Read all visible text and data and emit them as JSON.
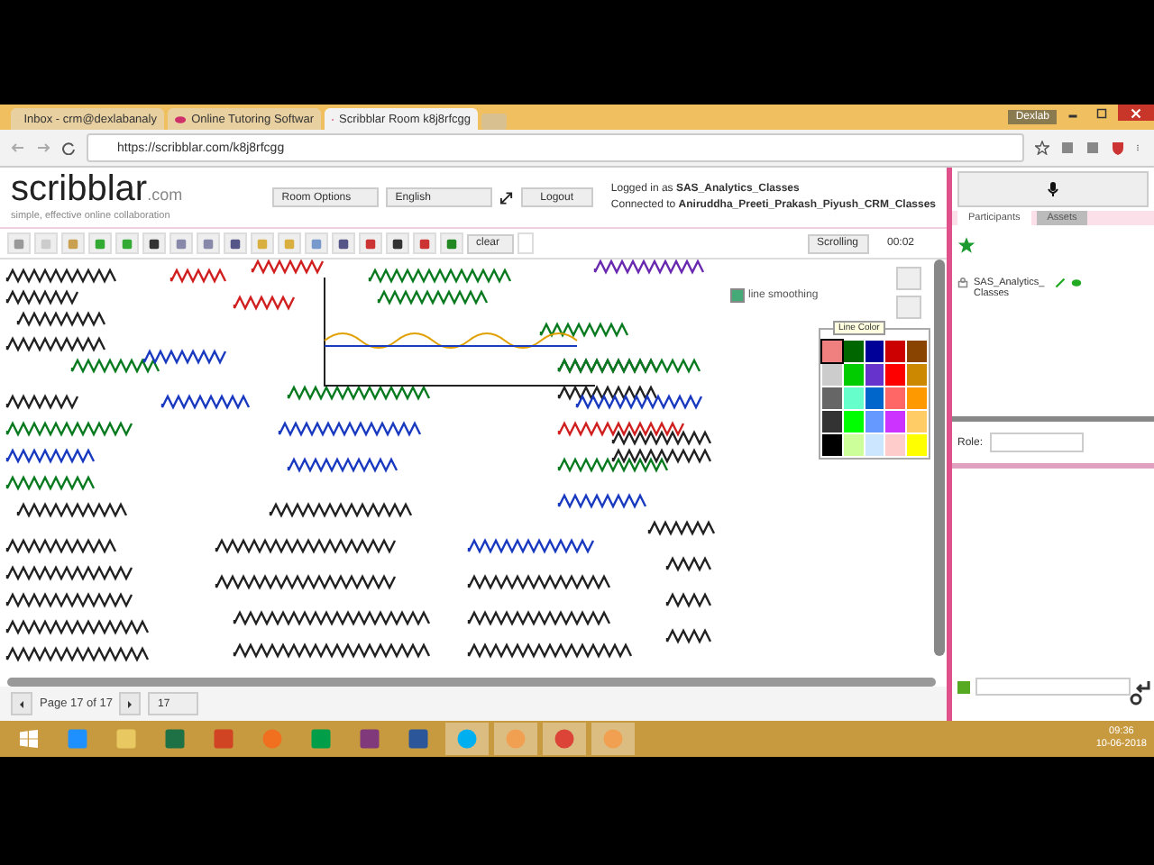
{
  "browser": {
    "tabs": [
      {
        "label": "Inbox - crm@dexlabanaly",
        "selected": false
      },
      {
        "label": "Online Tutoring Softwar",
        "selected": false
      },
      {
        "label": "Scribblar Room k8j8rfcgg",
        "selected": true
      }
    ],
    "profile": "Dexlab",
    "address": "https://scribblar.com/k8j8rfcgg"
  },
  "header": {
    "logo": "scribblar",
    "logo_suffix": ".com",
    "tagline": "simple, effective online collaboration",
    "room_options": "Room Options",
    "language": "English",
    "logout": "Logout",
    "logged_in": "Logged in as **SAS_Analytics_Classes**",
    "connected": "Connected to **Aniruddha_Preeti_Prakash_Piyush_CRM_Classes**"
  },
  "toolbar": {
    "clear": "clear",
    "mode": "Scrolling",
    "timer": "00:02"
  },
  "whiteboard": {
    "line_smoothing": {
      "label": "line smoothing",
      "checked": true
    },
    "color_tooltip": "Line Color",
    "swatches": [
      {
        "color": "#f08080",
        "selected": true
      },
      {
        "color": "#006600",
        "selected": false
      },
      {
        "color": "#000099",
        "selected": false
      },
      {
        "color": "#cc0000",
        "selected": false
      },
      {
        "color": "#884400",
        "selected": false
      },
      {
        "color": "#cccccc",
        "selected": false
      },
      {
        "color": "#00cc00",
        "selected": false
      },
      {
        "color": "#6633cc",
        "selected": false
      },
      {
        "color": "#ff0000",
        "selected": false
      },
      {
        "color": "#cc8800",
        "selected": false
      },
      {
        "color": "#666666",
        "selected": false
      },
      {
        "color": "#66ffcc",
        "selected": false
      },
      {
        "color": "#0066cc",
        "selected": false
      },
      {
        "color": "#ff6666",
        "selected": false
      },
      {
        "color": "#ff9900",
        "selected": false
      },
      {
        "color": "#333333",
        "selected": false
      },
      {
        "color": "#00ff00",
        "selected": false
      },
      {
        "color": "#6699ff",
        "selected": false
      },
      {
        "color": "#cc33ff",
        "selected": false
      },
      {
        "color": "#ffcc66",
        "selected": false
      },
      {
        "color": "#000000",
        "selected": false
      },
      {
        "color": "#ccff99",
        "selected": false
      },
      {
        "color": "#cce6ff",
        "selected": false
      },
      {
        "color": "#ffcccc",
        "selected": false
      },
      {
        "color": "#ffff00",
        "selected": false
      }
    ]
  },
  "pager": {
    "label": "Page 17 of 17",
    "page": "17"
  },
  "side": {
    "tabs": [
      {
        "label": "Participants",
        "selected": true
      },
      {
        "label": "Assets",
        "selected": false
      }
    ],
    "participants": [
      {
        "name": "SAS_Analytics_Classes"
      }
    ],
    "role_label": "Role:"
  },
  "taskbar": {
    "apps": [
      {
        "kind": "ie",
        "selected": false
      },
      {
        "kind": "folder",
        "selected": false
      },
      {
        "kind": "excel",
        "selected": false
      },
      {
        "kind": "powerpoint",
        "selected": false
      },
      {
        "kind": "firefox",
        "selected": false
      },
      {
        "kind": "store",
        "selected": false
      },
      {
        "kind": "onenote",
        "selected": false
      },
      {
        "kind": "word",
        "selected": false
      },
      {
        "kind": "skype",
        "selected": true
      },
      {
        "kind": "flower",
        "selected": true
      },
      {
        "kind": "chrome",
        "selected": true
      },
      {
        "kind": "flower",
        "selected": true
      }
    ],
    "time": "09:36",
    "date": "10-06-2018"
  }
}
